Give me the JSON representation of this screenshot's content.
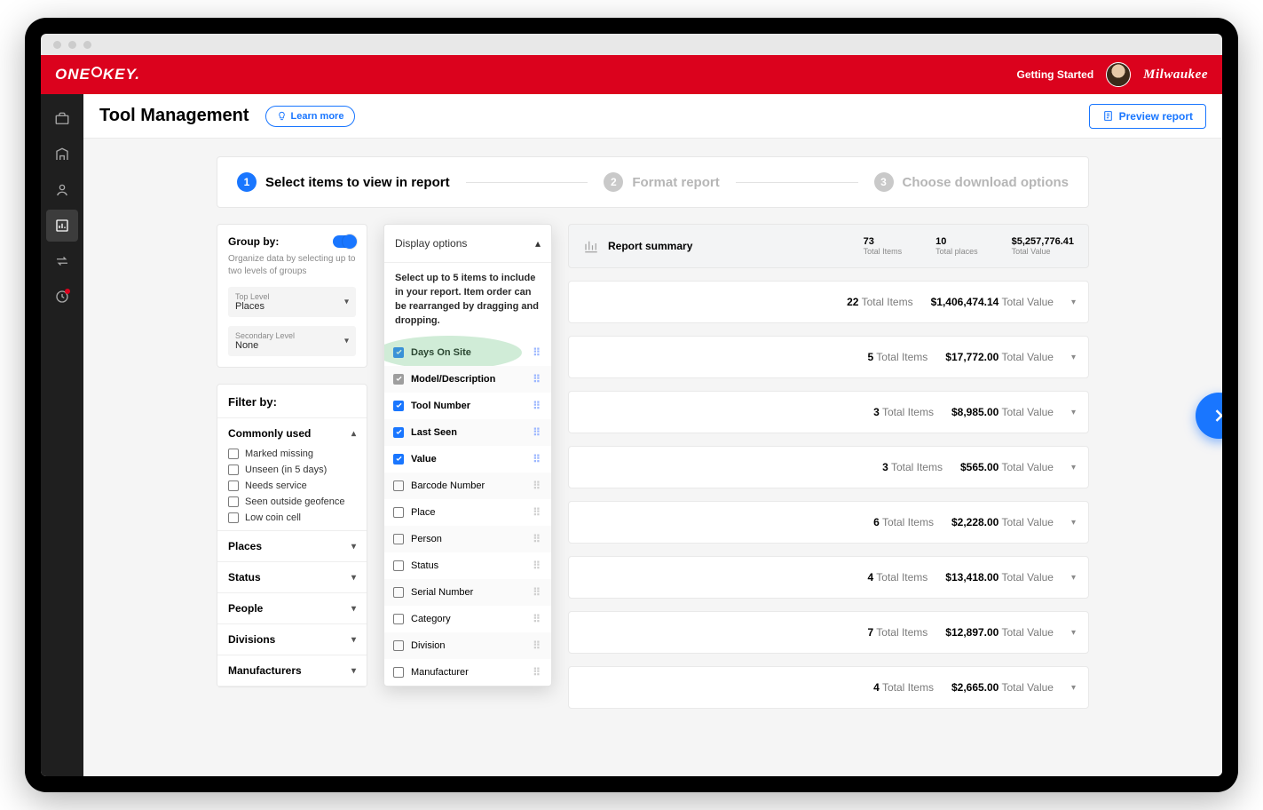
{
  "brand": {
    "logo_left": "ONE↕KEY",
    "logo_right": "Milwaukee",
    "getting_started": "Getting Started"
  },
  "page": {
    "title": "Tool Management",
    "learn_more": "Learn more",
    "preview_report": "Preview report"
  },
  "stepper": {
    "steps": [
      {
        "num": "1",
        "label": "Select items to view in report",
        "active": true
      },
      {
        "num": "2",
        "label": "Format report",
        "active": false
      },
      {
        "num": "3",
        "label": "Choose download options",
        "active": false
      }
    ]
  },
  "group_by": {
    "title": "Group by:",
    "desc": "Organize data by selecting up to two levels of groups",
    "top": {
      "label": "Top Level",
      "value": "Places"
    },
    "secondary": {
      "label": "Secondary Level",
      "value": "None"
    }
  },
  "filter": {
    "title": "Filter by:",
    "commonly_used": {
      "label": "Commonly used",
      "items": [
        "Marked missing",
        "Unseen (in 5 days)",
        "Needs service",
        "Seen outside geofence",
        "Low coin cell"
      ]
    },
    "sections": [
      "Places",
      "Status",
      "People",
      "Divisions",
      "Manufacturers"
    ]
  },
  "display_options": {
    "header": "Display options",
    "help": "Select up to 5 items to include in your report. Item order can be rearranged by dragging and dropping.",
    "items": [
      {
        "label": "Days On Site",
        "checked": true,
        "locked": false,
        "highlighted": true
      },
      {
        "label": "Model/Description",
        "checked": true,
        "locked": true
      },
      {
        "label": "Tool Number",
        "checked": true,
        "locked": false
      },
      {
        "label": "Last Seen",
        "checked": true,
        "locked": false
      },
      {
        "label": "Value",
        "checked": true,
        "locked": false
      },
      {
        "label": "Barcode Number",
        "checked": false
      },
      {
        "label": "Place",
        "checked": false
      },
      {
        "label": "Person",
        "checked": false
      },
      {
        "label": "Status",
        "checked": false
      },
      {
        "label": "Serial Number",
        "checked": false
      },
      {
        "label": "Category",
        "checked": false
      },
      {
        "label": "Division",
        "checked": false
      },
      {
        "label": "Manufacturer",
        "checked": false
      }
    ]
  },
  "summary": {
    "title": "Report summary",
    "stats": [
      {
        "value": "73",
        "label": "Total Items"
      },
      {
        "value": "10",
        "label": "Total places"
      },
      {
        "value": "$5,257,776.41",
        "label": "Total Value"
      }
    ]
  },
  "rows": [
    {
      "items": "22",
      "value": "$1,406,474.14"
    },
    {
      "items": "5",
      "value": "$17,772.00"
    },
    {
      "items": "3",
      "value": "$8,985.00"
    },
    {
      "items": "3",
      "value": "$565.00"
    },
    {
      "items": "6",
      "value": "$2,228.00"
    },
    {
      "items": "4",
      "value": "$13,418.00"
    },
    {
      "items": "7",
      "value": "$12,897.00"
    },
    {
      "items": "4",
      "value": "$2,665.00"
    }
  ],
  "labels": {
    "total_items": "Total Items",
    "total_value": "Total Value"
  }
}
